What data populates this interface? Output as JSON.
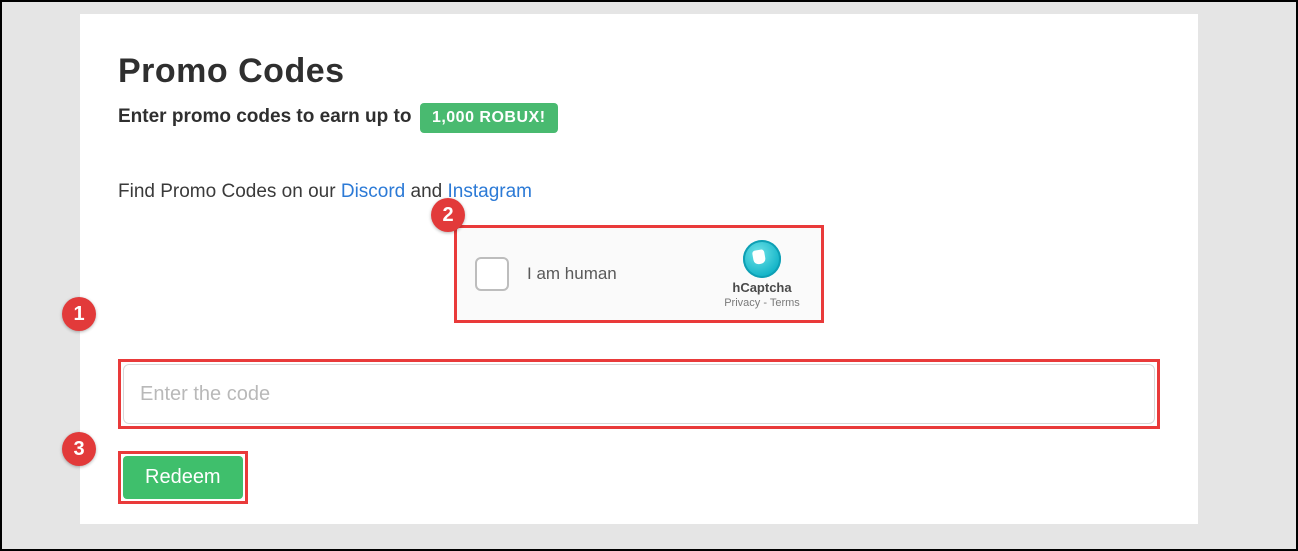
{
  "header": {
    "title": "Promo Codes",
    "subtitle": "Enter promo codes to earn up to",
    "badge": "1,000 ROBUX!"
  },
  "find": {
    "prefix": "Find Promo Codes on our ",
    "discord": "Discord",
    "mid": " and ",
    "instagram": "Instagram"
  },
  "captcha": {
    "label": "I am human",
    "brand": "hCaptcha",
    "privacy": "Privacy",
    "sep": " - ",
    "terms": "Terms"
  },
  "input": {
    "placeholder": "Enter the code",
    "value": ""
  },
  "redeem": {
    "label": "Redeem"
  },
  "callouts": {
    "one": "1",
    "two": "2",
    "three": "3"
  }
}
